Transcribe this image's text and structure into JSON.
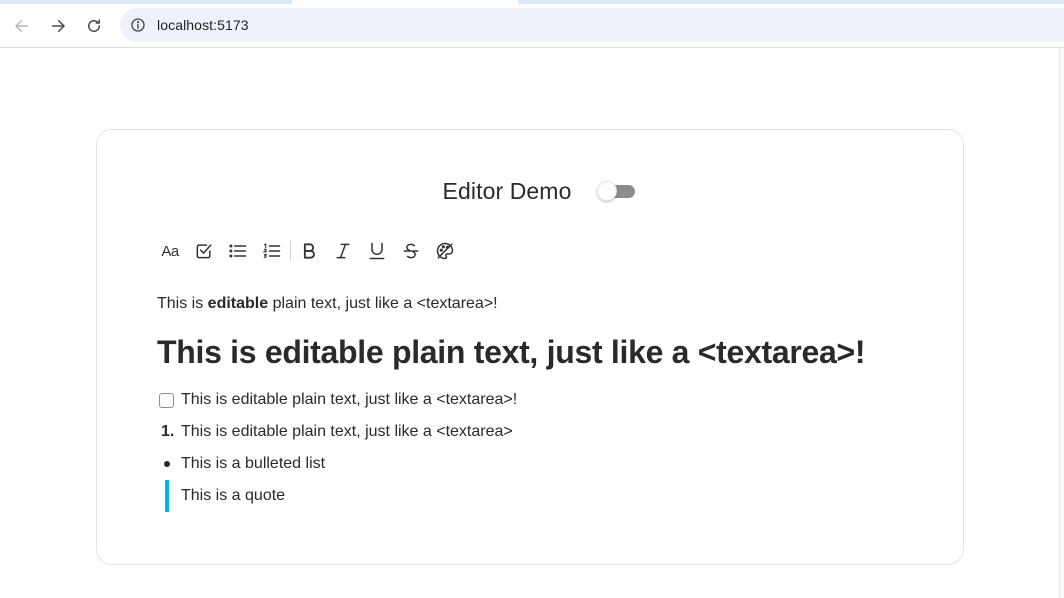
{
  "browser": {
    "url": "localhost:5173",
    "icons": {
      "back": "arrow-left-icon",
      "forward": "arrow-right-icon",
      "reload": "reload-icon",
      "site_info": "info-icon"
    }
  },
  "editor": {
    "title": "Editor Demo",
    "toggle_on": false,
    "toolbar": {
      "text_style_label": "Aa",
      "buttons": [
        "text-style",
        "checklist",
        "bulleted-list",
        "numbered-list",
        "bold",
        "italic",
        "underline",
        "strikethrough",
        "clear-formatting"
      ]
    },
    "content": {
      "paragraph_prefix": "This is ",
      "paragraph_bold": "editable",
      "paragraph_suffix": " plain text, just like a <textarea>!",
      "heading": "This is editable plain text, just like a <textarea>!",
      "checklist_item": "This is editable plain text, just like a <textarea>!",
      "numbered_marker": "1.",
      "numbered_item": "This is editable plain text, just like a <textarea>",
      "bulleted_item": "This is a bulleted list",
      "quote": "This is a quote"
    },
    "colors": {
      "quote_bar": "#00b1e8",
      "toggle_track": "#8c8c8c"
    }
  }
}
